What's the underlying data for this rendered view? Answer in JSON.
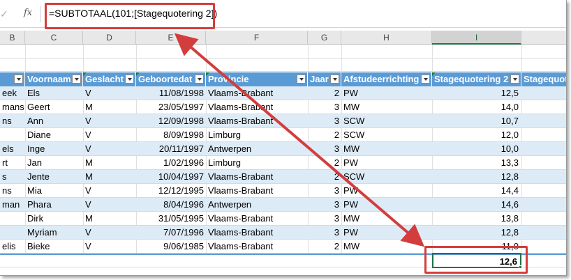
{
  "formula_bar": {
    "cancel_icon": "✓",
    "fx_label": "fx",
    "formula": "=SUBTOTAAL(101;[Stagequotering 2])"
  },
  "column_headers": [
    "B",
    "C",
    "D",
    "E",
    "F",
    "G",
    "H",
    "I"
  ],
  "table": {
    "headers": [
      "",
      "Voornaam",
      "Geslacht",
      "Geboortedat",
      "Provincie",
      "Jaar",
      "Afstudeerrichting",
      "Stagequotering 2",
      "Stagequot"
    ],
    "rows": [
      [
        "eek",
        "Els",
        "V",
        "11/08/1998",
        "Vlaams-Brabant",
        "2",
        "PW",
        "12,5"
      ],
      [
        "mans",
        "Geert",
        "M",
        "23/05/1997",
        "Vlaams-Brabant",
        "3",
        "MW",
        "14,0"
      ],
      [
        "ns",
        "Ann",
        "V",
        "12/09/1998",
        "Vlaams-Brabant",
        "3",
        "SCW",
        "10,7"
      ],
      [
        "",
        "Diane",
        "V",
        "8/09/1998",
        "Limburg",
        "2",
        "SCW",
        "12,0"
      ],
      [
        "els",
        "Inge",
        "V",
        "20/11/1997",
        "Antwerpen",
        "3",
        "MW",
        "10,0"
      ],
      [
        "rt",
        "Jan",
        "M",
        "1/02/1996",
        "Limburg",
        "2",
        "PW",
        "13,3"
      ],
      [
        "s",
        "Jente",
        "M",
        "10/04/1997",
        "Vlaams-Brabant",
        "2",
        "SCW",
        "12,8"
      ],
      [
        "ns",
        "Mia",
        "V",
        "12/12/1995",
        "Vlaams-Brabant",
        "3",
        "PW",
        "14,4"
      ],
      [
        "man",
        "Phara",
        "V",
        "8/04/1996",
        "Antwerpen",
        "3",
        "PW",
        "14,6"
      ],
      [
        "",
        "Dirk",
        "M",
        "31/05/1995",
        "Vlaams-Brabant",
        "3",
        "MW",
        "13,8"
      ],
      [
        "",
        "Myriam",
        "V",
        "7/07/1996",
        "Vlaams-Brabant",
        "3",
        "PW",
        "12,8"
      ],
      [
        "elis",
        "Bieke",
        "V",
        "9/06/1985",
        "Vlaams-Brabant",
        "2",
        "MW",
        "11,0"
      ]
    ],
    "total": "12,6"
  },
  "colors": {
    "header_blue": "#5b9bd5",
    "band_blue": "#ddebf7",
    "annotation_red": "#d33d3d",
    "excel_green": "#217346"
  }
}
